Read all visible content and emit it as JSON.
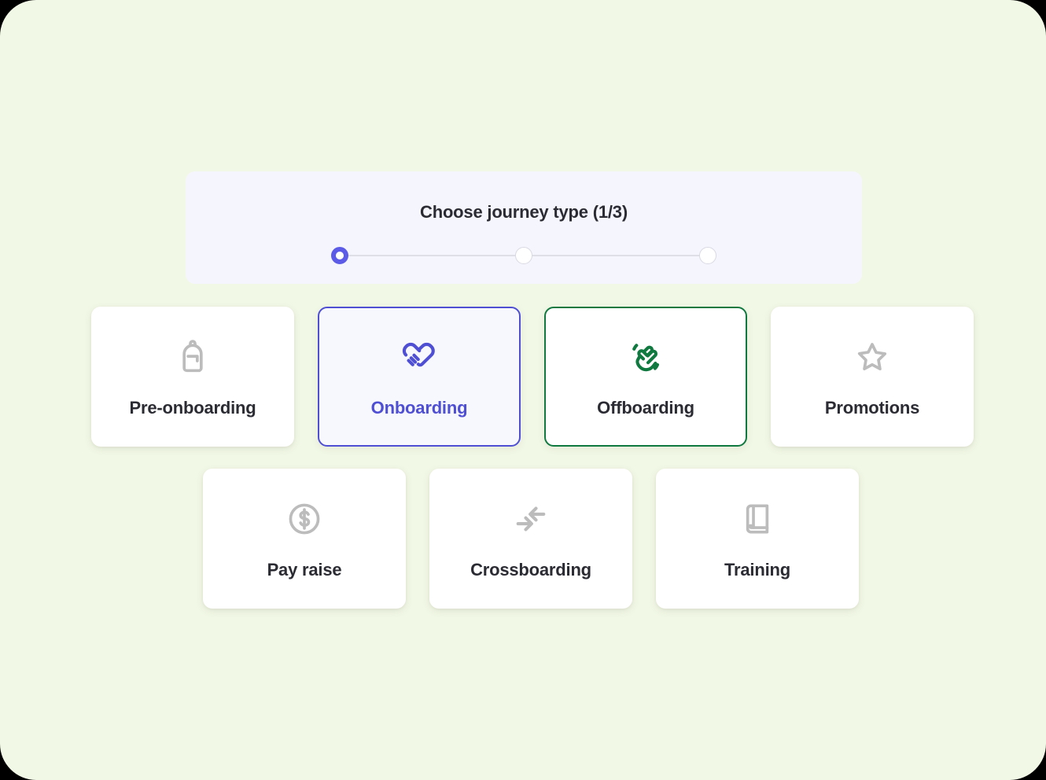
{
  "page": {
    "background_color": "#f2f8e6"
  },
  "header": {
    "title": "Choose journey type (1/3)",
    "card_background": "#f5f5fd",
    "stepper": {
      "current_step": 1,
      "total_steps": 3,
      "active_color": "#5b5be8",
      "inactive_color": "#ffffff",
      "line_color": "#dfdfe8",
      "steps": [
        {
          "index": 1,
          "state": "active"
        },
        {
          "index": 2,
          "state": "inactive"
        },
        {
          "index": 3,
          "state": "inactive"
        }
      ]
    }
  },
  "journey_types": {
    "selected_blue_color": "#4f4fd4",
    "selected_green_color": "#10793f",
    "default_icon_color": "#bcbcbc",
    "default_label_color": "#2b2b33",
    "rows": [
      {
        "cards": [
          {
            "label": "Pre-onboarding",
            "icon": "backpack-icon",
            "state": "default"
          },
          {
            "label": "Onboarding",
            "icon": "handshake-icon",
            "state": "selected-blue"
          },
          {
            "label": "Offboarding",
            "icon": "waving-hand-icon",
            "state": "selected-green"
          },
          {
            "label": "Promotions",
            "icon": "star-icon",
            "state": "default"
          }
        ]
      },
      {
        "cards": [
          {
            "label": "Pay raise",
            "icon": "dollar-circle-icon",
            "state": "default"
          },
          {
            "label": "Crossboarding",
            "icon": "converging-arrows-icon",
            "state": "default"
          },
          {
            "label": "Training",
            "icon": "book-icon",
            "state": "default"
          }
        ]
      }
    ]
  }
}
